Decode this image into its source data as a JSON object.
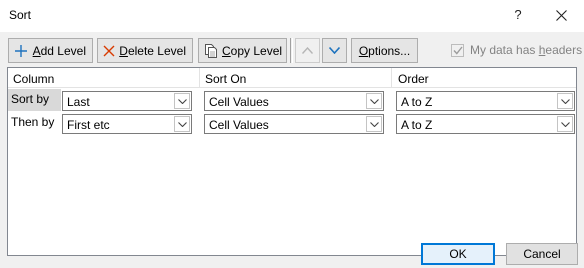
{
  "window": {
    "title": "Sort",
    "help_glyph": "?"
  },
  "toolbar": {
    "add_level_underlined": "A",
    "add_level_rest": "dd Level",
    "delete_level_underlined": "D",
    "delete_level_rest": "elete Level",
    "copy_level_underlined": "C",
    "copy_level_rest": "opy Level",
    "options_underlined": "O",
    "options_rest": "ptions...",
    "headers_prefix": "My data has ",
    "headers_underlined": "h",
    "headers_rest": "eaders",
    "headers_checked": true
  },
  "grid": {
    "columns": [
      "Column",
      "Sort On",
      "Order"
    ],
    "rows": [
      {
        "label": "Sort by",
        "column": "Last",
        "sort_on": "Cell Values",
        "order": "A to Z",
        "selected": true
      },
      {
        "label": "Then by",
        "column": "First etc",
        "sort_on": "Cell Values",
        "order": "A to Z",
        "selected": false
      }
    ]
  },
  "footer": {
    "ok_label": "OK",
    "cancel_label": "Cancel"
  },
  "colors": {
    "accent": "#0078d7",
    "disabled_text": "#838383",
    "button_face": "#e5e5e5"
  }
}
